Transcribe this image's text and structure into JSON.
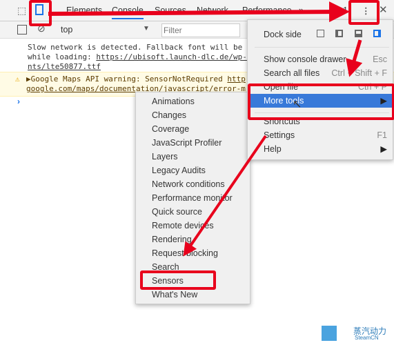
{
  "tabs": [
    "Elements",
    "Console",
    "Sources",
    "Network",
    "Performance"
  ],
  "overflow": "»",
  "warning_count": "1",
  "context_select": "top",
  "filter_placeholder": "Filter",
  "messages": {
    "m1_line1": "Slow network is detected. Fallback font will be",
    "m1_line2_prefix": "while loading: ",
    "m1_link": "https://ubisoft.launch-dlc.de/wp-",
    "m1_line3": "nts/lte50877.ttf",
    "m2_line1": "▶Google Maps API warning: SensorNotRequired ",
    "m2_link1": "http",
    "m2_line2": "google.com/maps/documentation/javascript/error-m"
  },
  "prompt": "›",
  "menu": {
    "dock_side": "Dock side",
    "items": [
      {
        "label": "Show console drawer",
        "shortcut": "Esc"
      },
      {
        "label": "Search all files",
        "shortcut": "Ctrl + Shift + F"
      },
      {
        "label": "Open file",
        "shortcut": "Ctrl + P"
      },
      {
        "label": "More tools",
        "shortcut": "▶"
      },
      {
        "label": "Shortcuts",
        "shortcut": ""
      },
      {
        "label": "Settings",
        "shortcut": "F1"
      },
      {
        "label": "Help",
        "shortcut": "▶"
      }
    ]
  },
  "submenu": [
    "Animations",
    "Changes",
    "Coverage",
    "JavaScript Profiler",
    "Layers",
    "Legacy Audits",
    "Network conditions",
    "Performance monitor",
    "Quick source",
    "Remote devices",
    "Rendering",
    "Request blocking",
    "Search",
    "Sensors",
    "What's New"
  ],
  "watermark": {
    "line1": "蒸汽动力",
    "line2": "SteamCN"
  },
  "colors": {
    "highlight": "#3879d9",
    "annotation": "#e8001c",
    "warning_bg": "#fffbe5"
  }
}
